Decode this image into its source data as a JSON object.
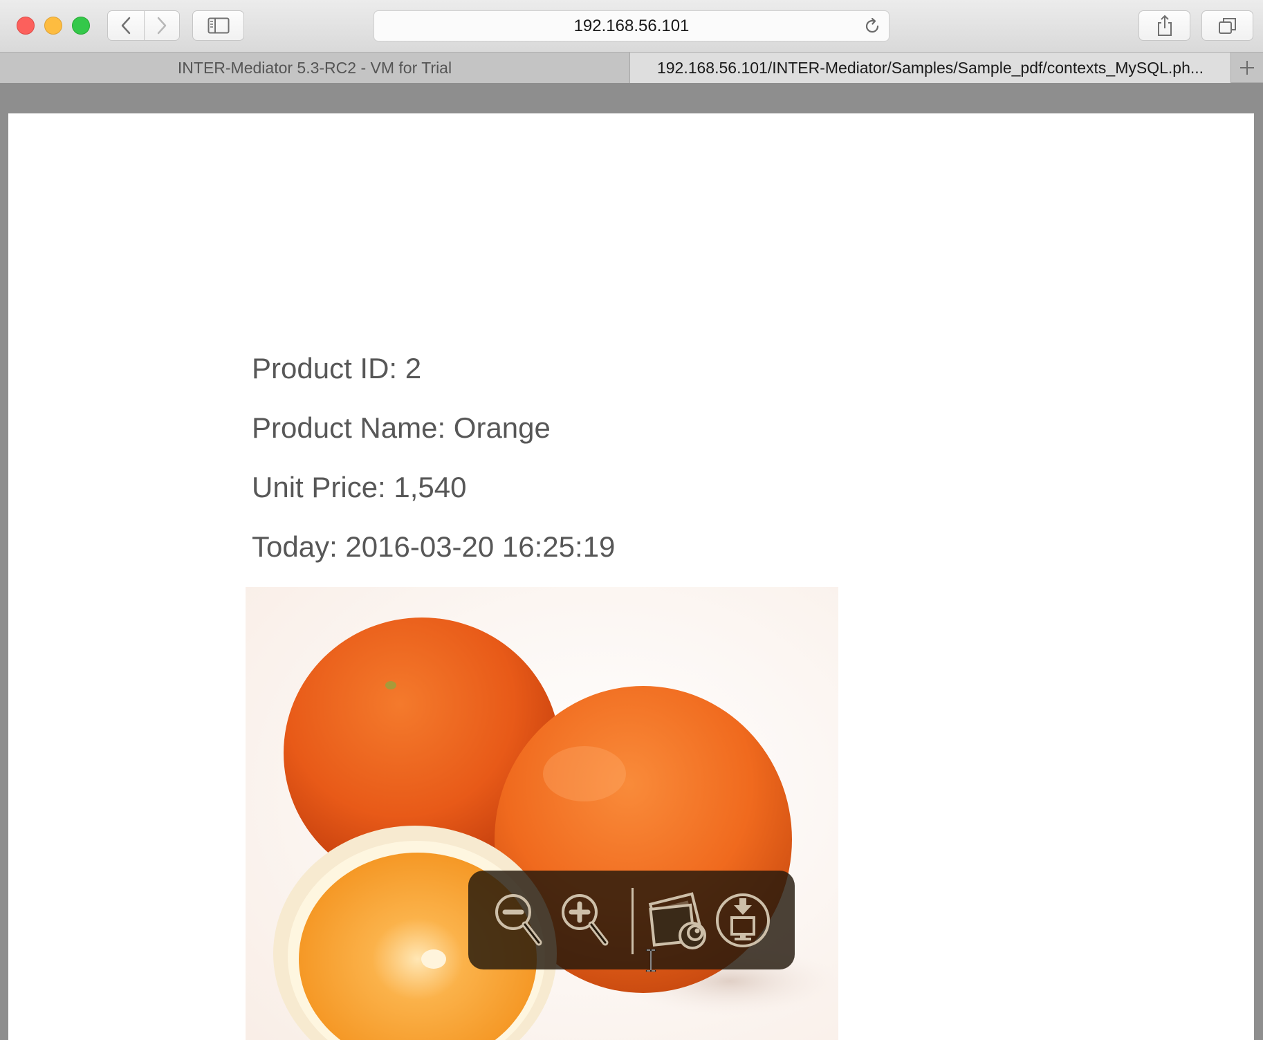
{
  "browser": {
    "address": "192.168.56.101",
    "tabs": [
      {
        "title": "INTER-Mediator 5.3-RC2 - VM for Trial",
        "active": false
      },
      {
        "title": "192.168.56.101/INTER-Mediator/Samples/Sample_pdf/contexts_MySQL.ph...",
        "active": true
      }
    ]
  },
  "document": {
    "fields": {
      "product_id": "Product ID: 2",
      "product_name": "Product Name: Orange",
      "unit_price": "Unit Price: 1,540",
      "today": "Today: 2016-03-20 16:25:19"
    },
    "image_subject": "oranges"
  },
  "preview_controls": [
    {
      "icon": "zoom-out-icon"
    },
    {
      "icon": "zoom-in-icon"
    },
    {
      "icon": "open-in-preview-icon"
    },
    {
      "icon": "download-icon"
    }
  ],
  "colors": {
    "page_background": "#ffffff",
    "text": "#575757",
    "hud_background": "#23190c",
    "hud_icon": "#cdbfa9"
  }
}
